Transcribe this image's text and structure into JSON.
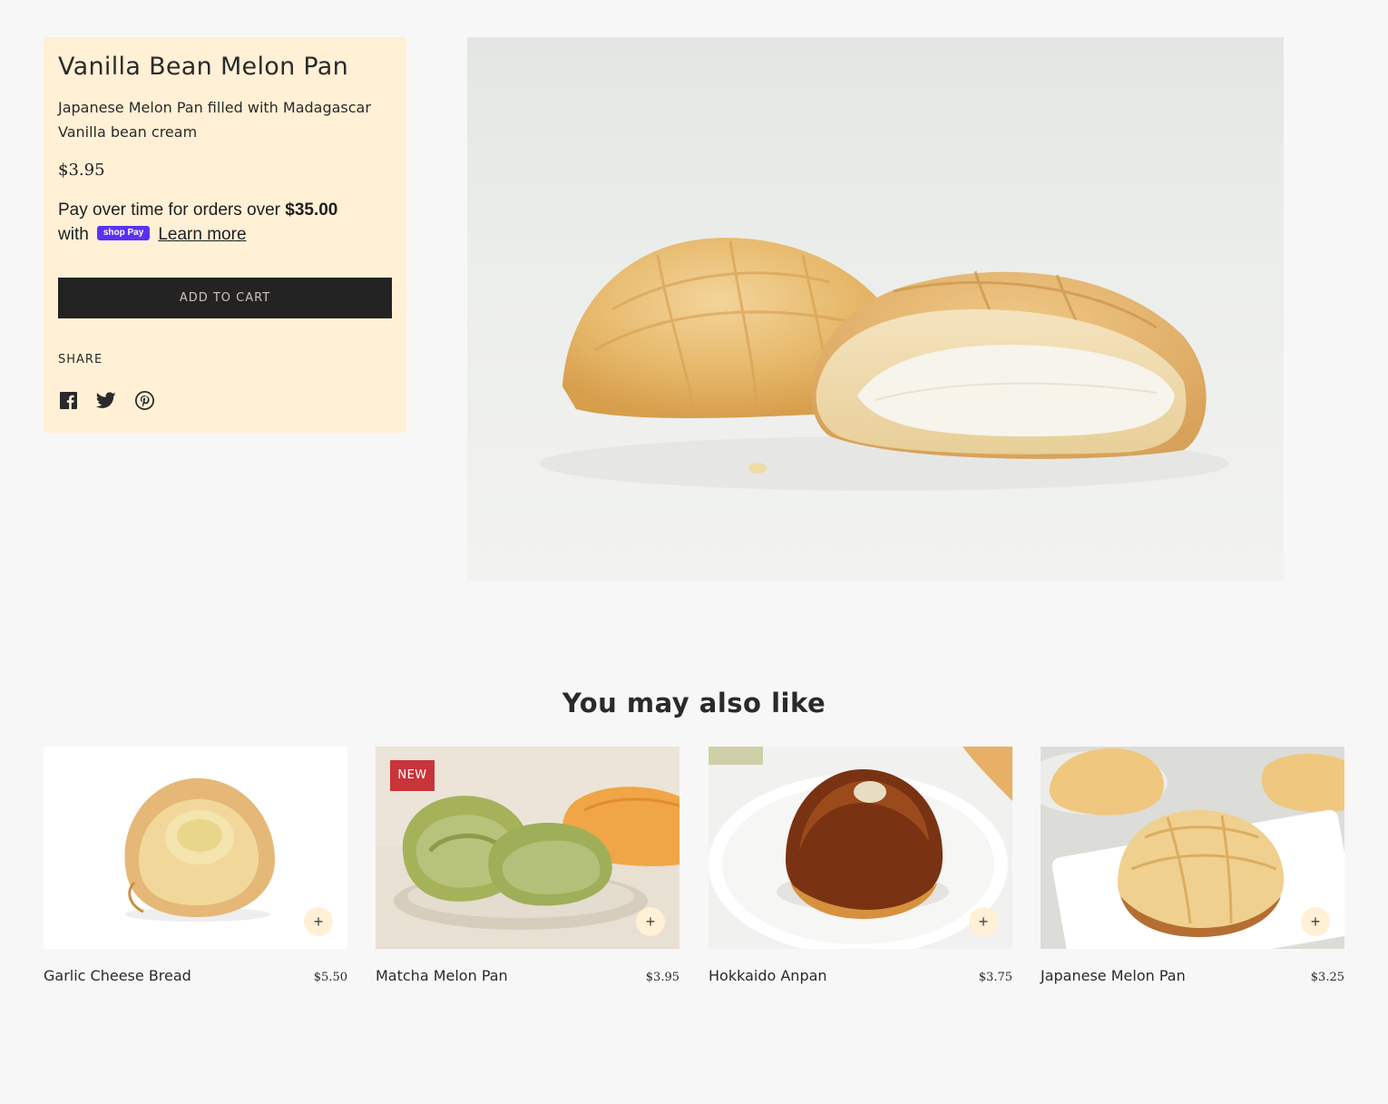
{
  "product": {
    "title": "Vanilla Bean Melon Pan",
    "description": "Japanese Melon Pan filled with Madagascar Vanilla bean cream",
    "price": "$3.95",
    "installments_prefix": "Pay over time for orders over",
    "installments_amount": "$35.00",
    "installments_with": "with",
    "shoppay_label": "shop Pay",
    "learn_more": "Learn more",
    "add_to_cart": "ADD TO CART",
    "share_label": "SHARE",
    "share_icons": [
      "facebook-icon",
      "twitter-icon",
      "pinterest-icon"
    ]
  },
  "related": {
    "title": "You may also like",
    "items": [
      {
        "name": "Garlic Cheese Bread",
        "price": "$5.50",
        "badge": ""
      },
      {
        "name": "Matcha Melon Pan",
        "price": "$3.95",
        "badge": "NEW"
      },
      {
        "name": "Hokkaido Anpan",
        "price": "$3.75",
        "badge": ""
      },
      {
        "name": "Japanese Melon Pan",
        "price": "$3.25",
        "badge": ""
      }
    ],
    "plus_label": "+"
  },
  "colors": {
    "panel_bg": "#fff0d6",
    "button_bg": "#232323",
    "badge_bg": "#c9333a",
    "shoppay": "#5a31f4",
    "page_bg": "#f7f7f7"
  }
}
